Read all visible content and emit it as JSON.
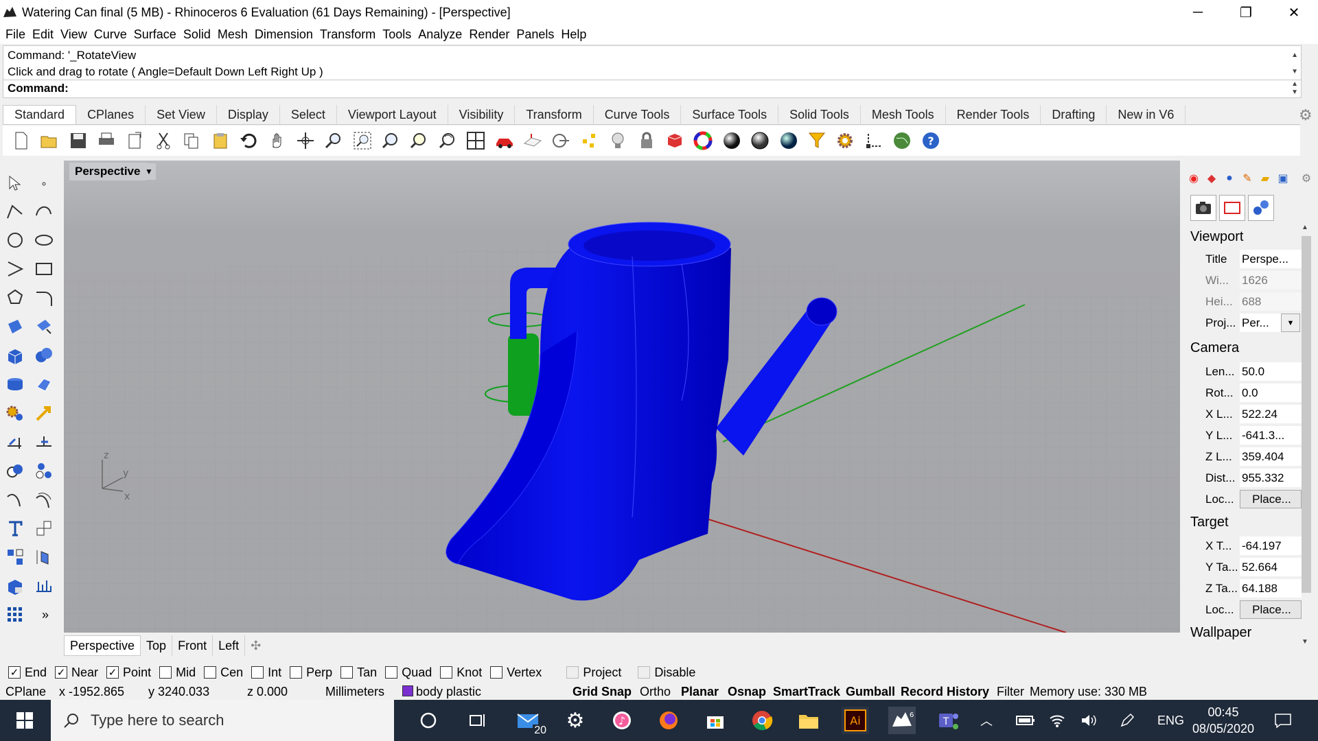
{
  "window": {
    "title": "Watering Can final (5 MB) - Rhinoceros 6 Evaluation (61 Days Remaining) - [Perspective]",
    "controls": {
      "minimize": "─",
      "restore": "❐",
      "close": "✕"
    }
  },
  "menu": [
    "File",
    "Edit",
    "View",
    "Curve",
    "Surface",
    "Solid",
    "Mesh",
    "Dimension",
    "Transform",
    "Tools",
    "Analyze",
    "Render",
    "Panels",
    "Help"
  ],
  "command": {
    "history_1": "Command: '_RotateView",
    "history_2": "Click and drag to rotate ( Angle=Default  Down  Left  Right  Up )",
    "prompt": "Command:"
  },
  "toolbar_tabs": [
    "Standard",
    "CPlanes",
    "Set View",
    "Display",
    "Select",
    "Viewport Layout",
    "Visibility",
    "Transform",
    "Curve Tools",
    "Surface Tools",
    "Solid Tools",
    "Mesh Tools",
    "Render Tools",
    "Drafting",
    "New in V6"
  ],
  "viewport": {
    "name": "Perspective",
    "axis_labels": {
      "z": "z",
      "y": "y",
      "x": "x"
    }
  },
  "viewport_tabs": [
    "Perspective",
    "Top",
    "Front",
    "Left"
  ],
  "properties": {
    "viewport_header": "Viewport",
    "viewport_rows": [
      {
        "key": "Title",
        "value": "Perspe..."
      },
      {
        "key": "Wi...",
        "value": "1626"
      },
      {
        "key": "Hei...",
        "value": "688"
      },
      {
        "key": "Proj...",
        "value": "Per..."
      }
    ],
    "camera_header": "Camera",
    "camera_rows": [
      {
        "key": "Len...",
        "value": "50.0"
      },
      {
        "key": "Rot...",
        "value": "0.0"
      },
      {
        "key": "X L...",
        "value": "522.24"
      },
      {
        "key": "Y L...",
        "value": "-641.3..."
      },
      {
        "key": "Z L...",
        "value": "359.404"
      },
      {
        "key": "Dist...",
        "value": "955.332"
      },
      {
        "key": "Loc...",
        "value": "Place..."
      }
    ],
    "target_header": "Target",
    "target_rows": [
      {
        "key": "X T...",
        "value": "-64.197"
      },
      {
        "key": "Y Ta...",
        "value": "52.664"
      },
      {
        "key": "Z Ta...",
        "value": "64.188"
      },
      {
        "key": "Loc...",
        "value": "Place..."
      }
    ],
    "wallpaper_header": "Wallpaper"
  },
  "osnaps": [
    {
      "label": "End",
      "checked": true
    },
    {
      "label": "Near",
      "checked": true
    },
    {
      "label": "Point",
      "checked": true
    },
    {
      "label": "Mid",
      "checked": false
    },
    {
      "label": "Cen",
      "checked": false
    },
    {
      "label": "Int",
      "checked": false
    },
    {
      "label": "Perp",
      "checked": false
    },
    {
      "label": "Tan",
      "checked": false
    },
    {
      "label": "Quad",
      "checked": false
    },
    {
      "label": "Knot",
      "checked": false
    },
    {
      "label": "Vertex",
      "checked": false
    },
    {
      "label": "Project",
      "checked": false
    },
    {
      "label": "Disable",
      "checked": false
    }
  ],
  "status": {
    "cplane": "CPlane",
    "x": "x -1952.865",
    "y": "y 3240.033",
    "z": "z 0.000",
    "units": "Millimeters",
    "layer": "body plastic",
    "layer_color": "#7b2fd0",
    "grid_snap": "Grid Snap",
    "ortho": "Ortho",
    "planar": "Planar",
    "osnap": "Osnap",
    "smarttrack": "SmartTrack",
    "gumball": "Gumball",
    "record_history": "Record History",
    "filter": "Filter",
    "memory": "Memory use: 330 MB"
  },
  "taskbar": {
    "search_placeholder": "Type here to search",
    "mail_badge": "20",
    "language": "ENG",
    "time": "00:45",
    "date": "08/05/2020"
  },
  "colors": {
    "model_blue": "#0a14ee",
    "handle_green": "#10a020",
    "x_axis": "#b02020",
    "y_axis": "#20a020"
  }
}
